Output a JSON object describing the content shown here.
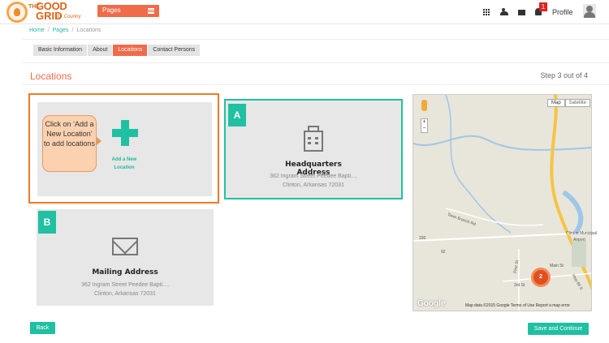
{
  "header": {
    "logo": {
      "small": "THE",
      "big1": "GOOD",
      "big2": "GRID",
      "script": "for Country"
    },
    "pages_dropdown": "Pages",
    "notification_count": "1",
    "profile_label": "Profile"
  },
  "breadcrumb": [
    "Home",
    "Pages",
    "Locations"
  ],
  "tabs": [
    "Basic Information",
    "About",
    "Locations",
    "Contact Persons"
  ],
  "active_tab": "Locations",
  "section_title": "Locations",
  "step_text": "Step 3 out of 4",
  "add_location": {
    "callout": "Click on ‘Add a New Location’ to add locations",
    "label": "Add a New Location"
  },
  "addresses": [
    {
      "badge": "A",
      "title": "Headquarters Address",
      "line1": "362 Ingram Street Peedee Bapti...,",
      "line2": "Clinton, Arkansas 72031",
      "icon": "building-icon"
    },
    {
      "badge": "B",
      "title": "Mailing Address",
      "line1": "362 Ingram Street Peedee Bapti...,",
      "line2": "Clinton, Arkansas 72031",
      "icon": "envelope-icon"
    }
  ],
  "map": {
    "tab_map": "Map",
    "tab_satellite": "Satellite",
    "zoom_in": "+",
    "zoom_out": "−",
    "marker_count": "2",
    "footer": "Map data ©2015 Google   Terms of Use   Report a map error",
    "google": "Google",
    "labels": [
      "Town Branch Rd",
      "Clinton Municipal",
      "Airport",
      "Main St",
      "3rd St",
      "Pine St",
      "Hwy 65 S",
      "65",
      "92",
      "330"
    ]
  },
  "buttons": {
    "back": "Back",
    "save": "Save and Continue"
  },
  "colors": {
    "accent_orange": "#ef6c4b",
    "accent_teal": "#20c0a2",
    "callout_fill": "#fcd1b0"
  }
}
